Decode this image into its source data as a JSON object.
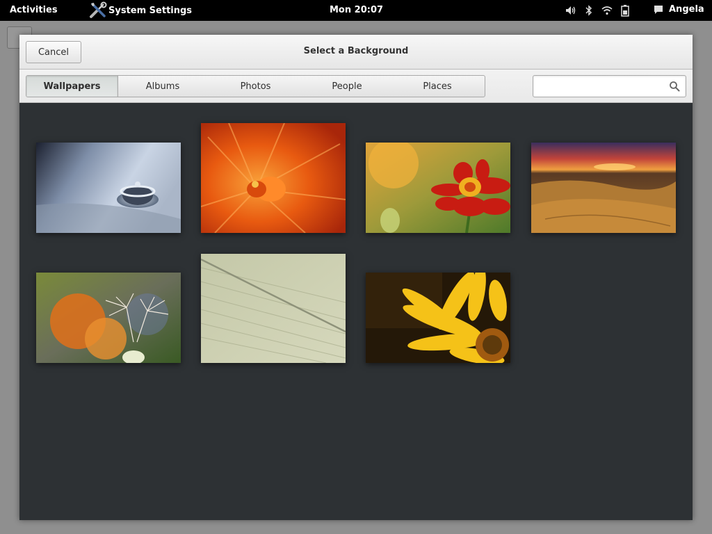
{
  "topbar": {
    "activities": "Activities",
    "app_name": "System Settings",
    "clock": "Mon 20:07",
    "user_name": "Angela",
    "tray_icons": [
      "volume-icon",
      "bluetooth-icon",
      "wifi-icon",
      "battery-icon"
    ]
  },
  "dialog": {
    "title": "Select a Background",
    "cancel_label": "Cancel",
    "tabs": [
      {
        "label": "Wallpapers",
        "selected": true
      },
      {
        "label": "Albums",
        "selected": false
      },
      {
        "label": "Photos",
        "selected": false
      },
      {
        "label": "People",
        "selected": false
      },
      {
        "label": "Places",
        "selected": false
      }
    ],
    "search": {
      "value": "",
      "placeholder": ""
    }
  },
  "wallpapers": [
    {
      "name": "water-drop"
    },
    {
      "name": "orange-flower-closeup"
    },
    {
      "name": "red-marigold"
    },
    {
      "name": "desert-sunset"
    },
    {
      "name": "dandelion-seeds"
    },
    {
      "name": "wooden-planks"
    },
    {
      "name": "yellow-flower"
    }
  ],
  "colors": {
    "topbar_bg": "#000000",
    "dialog_bg": "#2d3134",
    "header_bg": "#ececec"
  }
}
